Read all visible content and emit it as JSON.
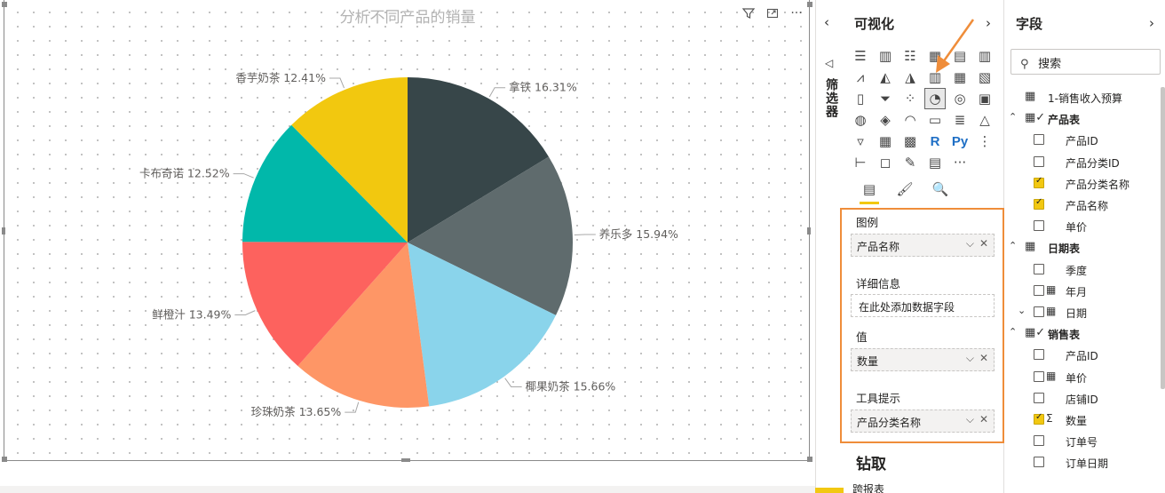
{
  "chart": {
    "title": "分析不同产品的销量",
    "header_icons": [
      "filter-icon",
      "focus-mode-icon",
      "more-options-icon"
    ]
  },
  "chart_data": {
    "type": "pie",
    "title": "分析不同产品的销量",
    "slices": [
      {
        "label": "拿铁",
        "value": 16.31,
        "display": "拿铁 16.31%",
        "color": "#374649"
      },
      {
        "label": "养乐多",
        "value": 15.94,
        "display": "养乐多 15.94%",
        "color": "#5f6b6d"
      },
      {
        "label": "椰果奶茶",
        "value": 15.66,
        "display": "椰果奶茶 15.66%",
        "color": "#8ad4eb"
      },
      {
        "label": "珍珠奶茶",
        "value": 13.65,
        "display": "珍珠奶茶 13.65%",
        "color": "#fe9666"
      },
      {
        "label": "鲜橙汁",
        "value": 13.49,
        "display": "鲜橙汁 13.49%",
        "color": "#fd625e"
      },
      {
        "label": "卡布奇诺",
        "value": 12.52,
        "display": "卡布奇诺 12.52%",
        "color": "#01b8aa"
      },
      {
        "label": "香芋奶茶",
        "value": 12.41,
        "display": "香芋奶茶 12.41%",
        "color": "#f2c80f"
      }
    ]
  },
  "filters": {
    "label": "筛选器"
  },
  "visualizations": {
    "title": "可视化",
    "icons": [
      "stacked-bar-icon",
      "stacked-column-icon",
      "clustered-bar-icon",
      "clustered-column-icon",
      "100-stacked-bar-icon",
      "100-stacked-column-icon",
      "line-chart-icon",
      "area-chart-icon",
      "stacked-area-icon",
      "line-column-icon",
      "line-clustered-column-icon",
      "ribbon-chart-icon",
      "waterfall-icon",
      "funnel-icon",
      "scatter-icon",
      "pie-chart-icon",
      "donut-chart-icon",
      "treemap-icon",
      "map-icon",
      "filled-map-icon",
      "gauge-icon",
      "card-icon",
      "multirow-card-icon",
      "kpi-icon",
      "slicer-icon",
      "table-icon",
      "matrix-icon",
      "r-visual-icon",
      "python-visual-icon",
      "key-influencers-icon",
      "decomposition-tree-icon",
      "qa-icon",
      "smart-narrative-icon",
      "paginated-report-icon",
      "more-visuals-icon"
    ],
    "selected_index": 15,
    "r_label": "R",
    "py_label": "Py",
    "more_label": "···",
    "subtabs": [
      "fields-tab-icon",
      "format-tab-icon",
      "analytics-tab-icon"
    ],
    "wells": {
      "legend_label": "图例",
      "legend_value": "产品名称",
      "details_label": "详细信息",
      "details_placeholder": "在此处添加数据字段",
      "values_label": "值",
      "values_value": "数量",
      "tooltips_label": "工具提示",
      "tooltips_value": "产品分类名称"
    },
    "drill_title": "钻取",
    "cross_report_label": "跨报表"
  },
  "fields": {
    "title": "字段",
    "search_placeholder": "搜索",
    "items": [
      {
        "kind": "table",
        "name": "1-销售收入预算",
        "expanded": false,
        "has_check": false
      },
      {
        "kind": "table",
        "name": "产品表",
        "expanded": true,
        "has_check": true
      },
      {
        "kind": "field",
        "name": "产品ID",
        "checked": false,
        "icon": ""
      },
      {
        "kind": "field",
        "name": "产品分类ID",
        "checked": false,
        "icon": ""
      },
      {
        "kind": "field",
        "name": "产品分类名称",
        "checked": true,
        "icon": ""
      },
      {
        "kind": "field",
        "name": "产品名称",
        "checked": true,
        "icon": ""
      },
      {
        "kind": "field",
        "name": "单价",
        "checked": false,
        "icon": ""
      },
      {
        "kind": "table",
        "name": "日期表",
        "expanded": true,
        "has_check": false
      },
      {
        "kind": "field",
        "name": "季度",
        "checked": false,
        "icon": ""
      },
      {
        "kind": "field",
        "name": "年月",
        "checked": false,
        "icon": "calendar-icon"
      },
      {
        "kind": "hierarchy",
        "name": "日期",
        "checked": false,
        "icon": "date-hierarchy-icon"
      },
      {
        "kind": "table",
        "name": "销售表",
        "expanded": true,
        "has_check": true
      },
      {
        "kind": "field",
        "name": "产品ID",
        "checked": false,
        "icon": ""
      },
      {
        "kind": "field",
        "name": "单价",
        "checked": false,
        "icon": "calculated-column-icon"
      },
      {
        "kind": "field",
        "name": "店铺ID",
        "checked": false,
        "icon": ""
      },
      {
        "kind": "field",
        "name": "数量",
        "checked": true,
        "icon": "sigma-icon"
      },
      {
        "kind": "field",
        "name": "订单号",
        "checked": false,
        "icon": ""
      },
      {
        "kind": "field",
        "name": "订单日期",
        "checked": false,
        "icon": ""
      }
    ]
  }
}
